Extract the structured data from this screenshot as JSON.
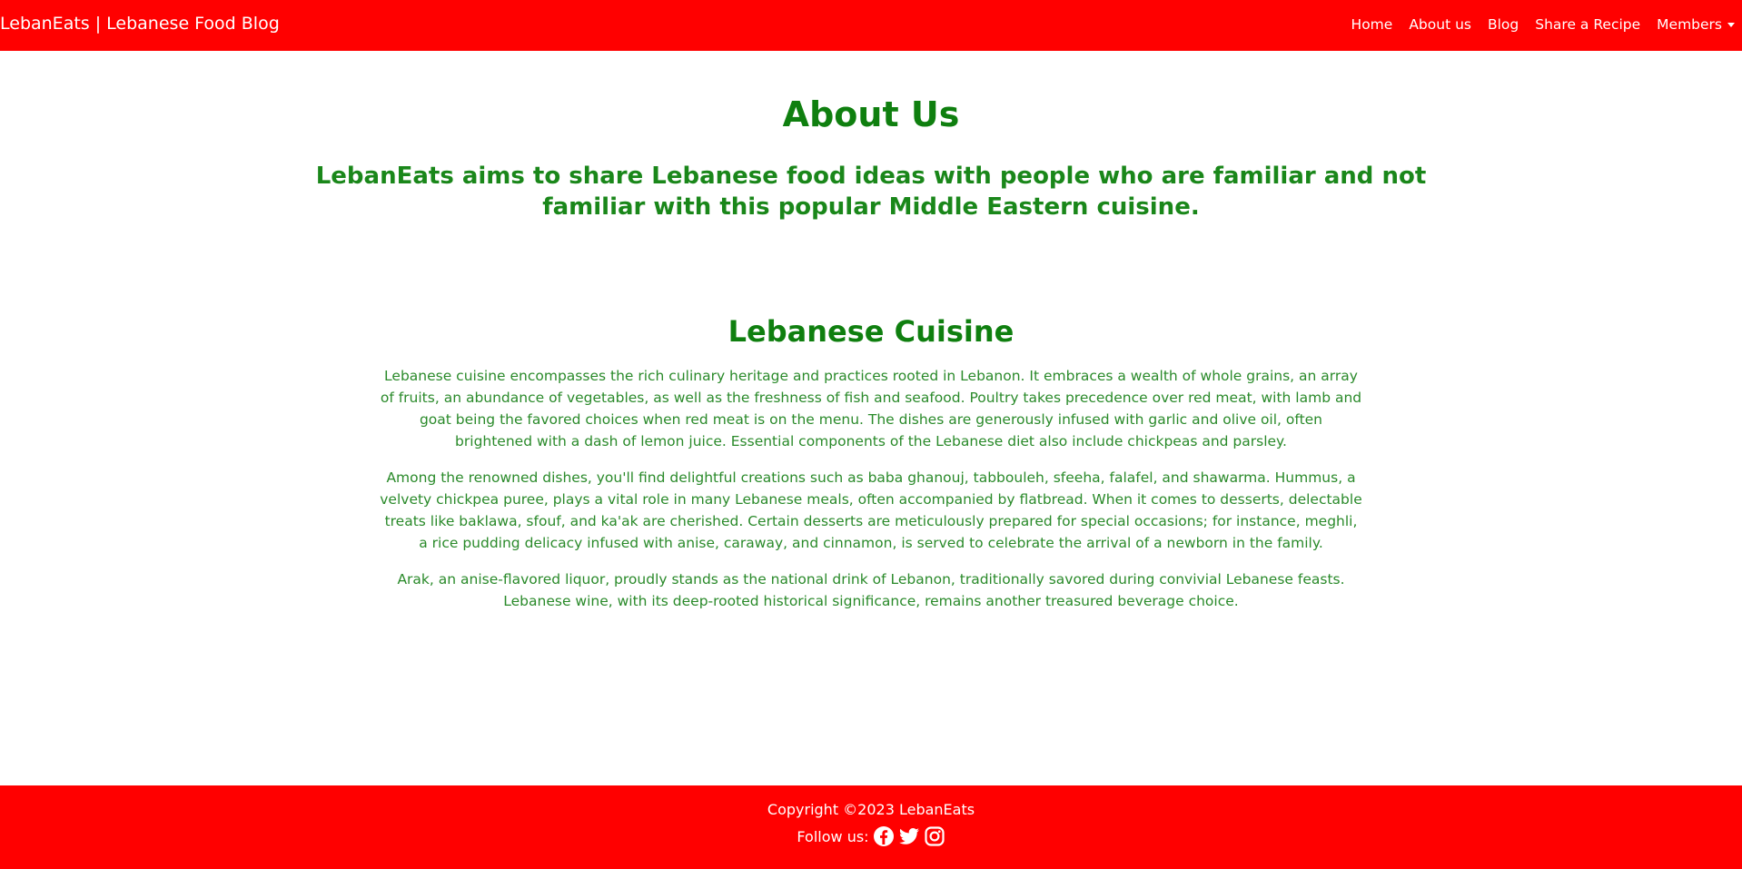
{
  "navbar": {
    "brand": "LebanEats | Lebanese Food Blog",
    "links": [
      {
        "label": "Home"
      },
      {
        "label": "About us"
      },
      {
        "label": "Blog"
      },
      {
        "label": "Share a Recipe"
      },
      {
        "label": "Members"
      }
    ]
  },
  "about": {
    "heading": "About Us",
    "tagline": "LebanEats aims to share Lebanese food ideas with people who are familiar and not familiar with this popular Middle Eastern cuisine."
  },
  "cuisine": {
    "heading": "Lebanese Cuisine",
    "paragraphs": [
      "Lebanese cuisine encompasses the rich culinary heritage and practices rooted in Lebanon. It embraces a wealth of whole grains, an array of fruits, an abundance of vegetables, as well as the freshness of fish and seafood. Poultry takes precedence over red meat, with lamb and goat being the favored choices when red meat is on the menu. The dishes are generously infused with garlic and olive oil, often brightened with a dash of lemon juice. Essential components of the Lebanese diet also include chickpeas and parsley.",
      "Among the renowned dishes, you'll find delightful creations such as baba ghanouj, tabbouleh, sfeeha, falafel, and shawarma. Hummus, a velvety chickpea puree, plays a vital role in many Lebanese meals, often accompanied by flatbread. When it comes to desserts, delectable treats like baklawa, sfouf, and ka'ak are cherished. Certain desserts are meticulously prepared for special occasions; for instance, meghli, a rice pudding delicacy infused with anise, caraway, and cinnamon, is served to celebrate the arrival of a newborn in the family.",
      "Arak, an anise-flavored liquor, proudly stands as the national drink of Lebanon, traditionally savored during convivial Lebanese feasts. Lebanese wine, with its deep-rooted historical significance, remains another treasured beverage choice."
    ]
  },
  "footer": {
    "copyright": "Copyright ©2023 LebanEats",
    "follow_label": "Follow us:",
    "social_icons": [
      "facebook-icon",
      "twitter-icon",
      "instagram-icon"
    ]
  },
  "colors": {
    "navbar_bg": "#ff0000",
    "heading_green": "#0f7f0f",
    "body_green": "#2a8a2a"
  }
}
